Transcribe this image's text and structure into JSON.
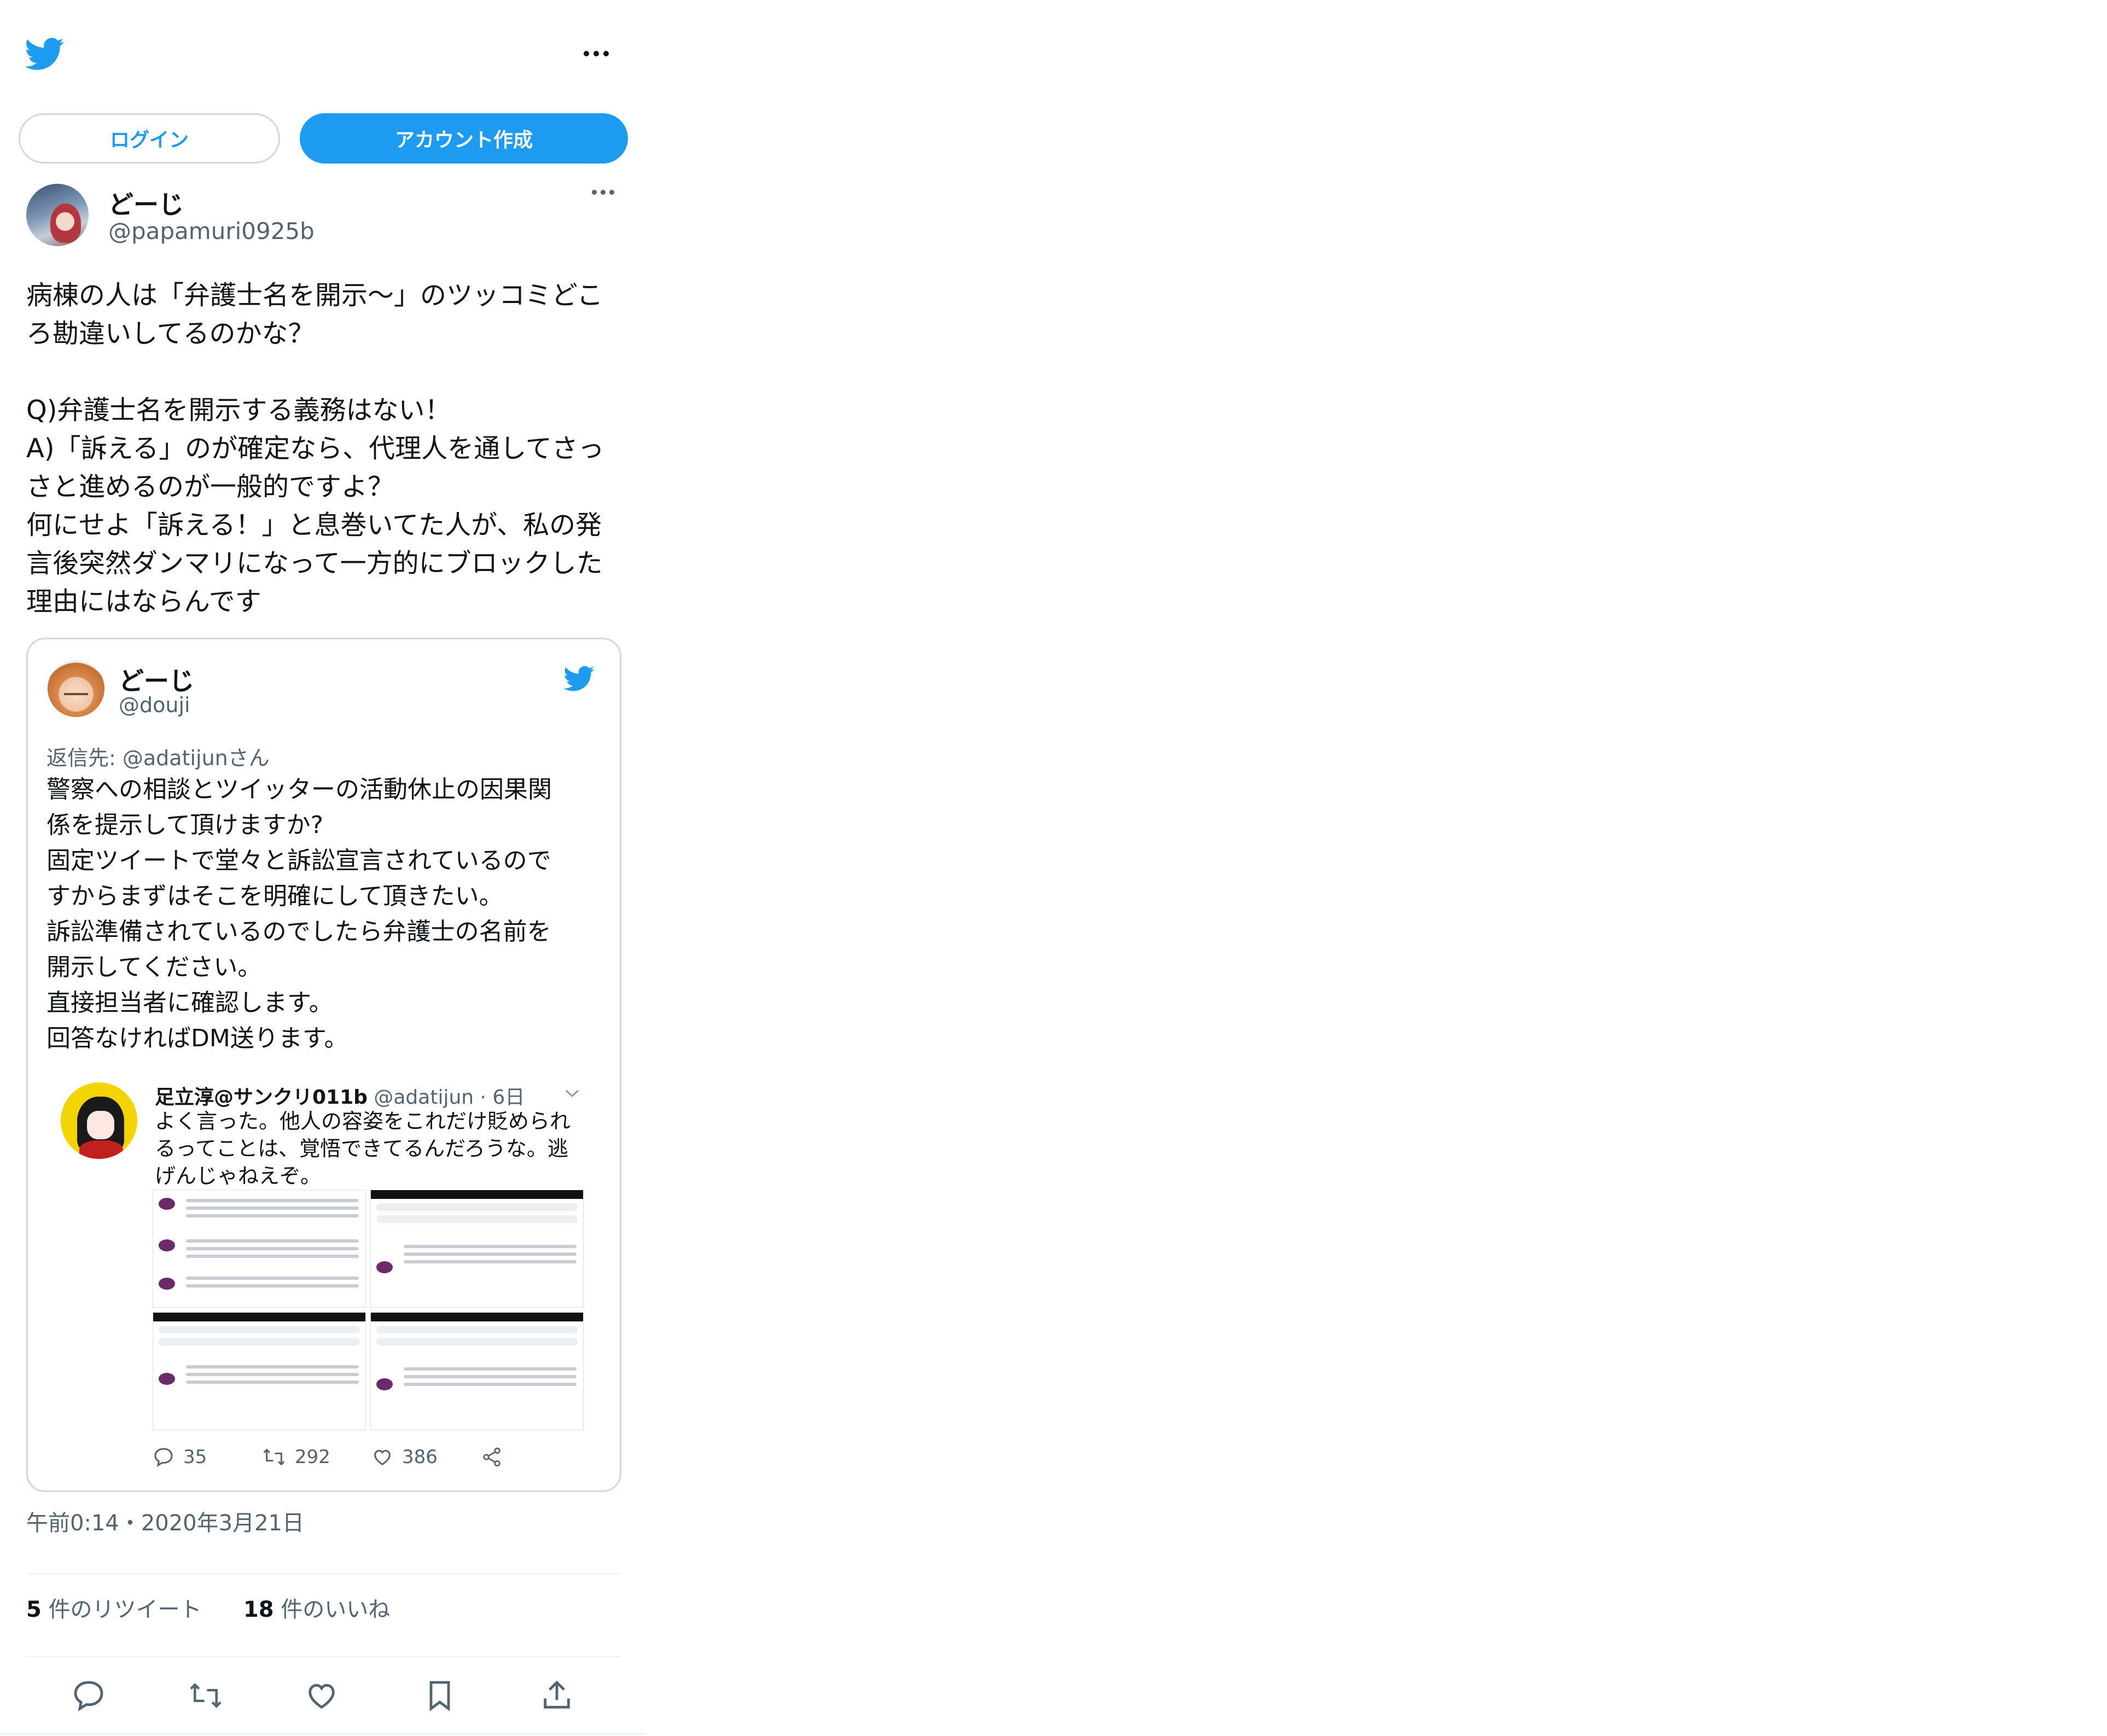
{
  "header": {
    "logo_icon": "twitter-bird-icon",
    "more_icon": "more-horizontal-icon"
  },
  "auth": {
    "login_label": "ログイン",
    "signup_label": "アカウント作成"
  },
  "author": {
    "name": "どーじ",
    "handle": "@papamuri0925b"
  },
  "tweet": {
    "lines": [
      "病棟の人は「弁護士名を開示〜」のツッコミどこ",
      "ろ勘違いしてるのかな？",
      "",
      "Q)弁護士名を開示する義務はない！",
      "A)「訴える」のが確定なら、代理人を通してさっ",
      "さと進めるのが一般的ですよ？",
      "何にせよ「訴える！」と息巻いてた人が、私の発",
      "言後突然ダンマリになって一方的にブロックした",
      "理由にはならんです"
    ]
  },
  "quoted": {
    "name": "どーじ",
    "handle": "@douji",
    "reply_to": "返信先: @adatijunさん",
    "lines": [
      "警察への相談とツイッターの活動休止の因果関",
      "係を提示して頂けますか?",
      "固定ツイートで堂々と訴訟宣言されているので",
      "すからまずはそこを明確にして頂きたい。",
      "訴訟準備されているのでしたら弁護士の名前を",
      "開示してください。",
      "直接担当者に確認します。",
      "回答なければDM送ります。"
    ],
    "inner": {
      "name": "足立淳@サンクリ011b",
      "handle_time": "@adatijun · 6日",
      "lines": [
        "よく言った。他人の容姿をこれだけ貶められ",
        "るってことは、覚悟できてるんだろうな。逃",
        "げんじゃねえぞ。"
      ]
    },
    "stats": {
      "replies": "35",
      "retweets": "292",
      "likes": "386"
    }
  },
  "timestamp": "午前0:14・2020年3月21日",
  "counts": {
    "retweets_num": "5",
    "retweets_label": "件のリツイート",
    "likes_num": "18",
    "likes_label": "件のいいね"
  },
  "action_icons": [
    "reply-icon",
    "retweet-icon",
    "like-icon",
    "bookmark-icon",
    "share-icon"
  ],
  "colors": {
    "accent": "#1d9bf0",
    "text": "#0f1419",
    "muted": "#536471",
    "border": "#cfd9de"
  }
}
